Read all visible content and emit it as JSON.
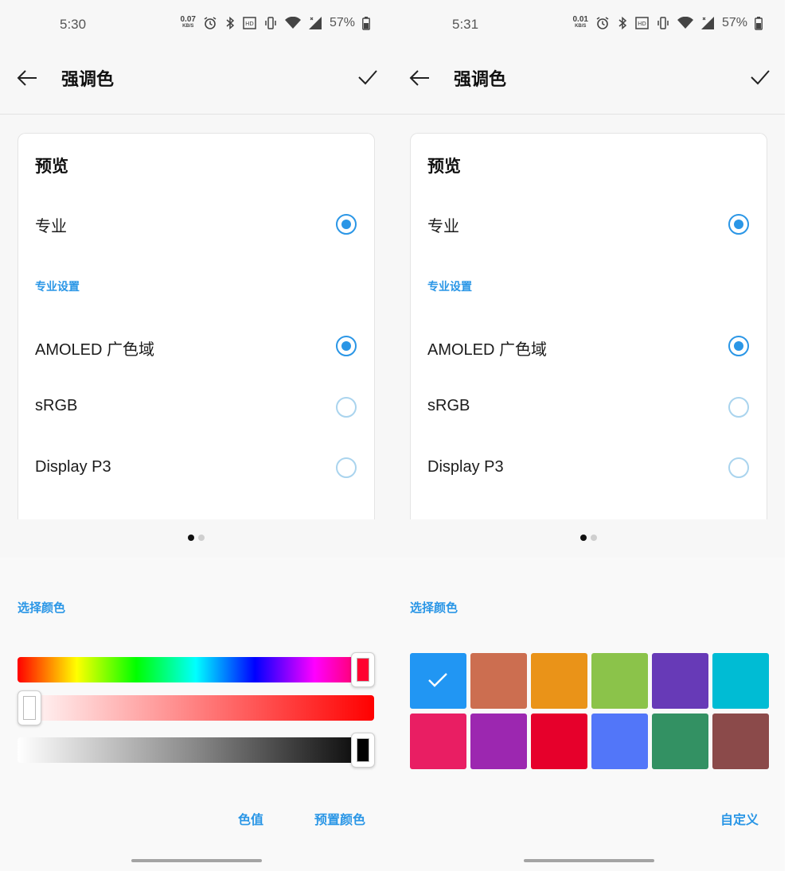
{
  "screens": [
    {
      "status": {
        "time": "5:30",
        "speed_value": "0.07",
        "speed_unit": "KB/S",
        "battery": "57%"
      },
      "title": "强调色",
      "preview": {
        "title": "预览",
        "mode_label": "专业",
        "section": "专业设置",
        "options": [
          "AMOLED 广色域",
          "sRGB",
          "Display P3"
        ],
        "selected_option": "AMOLED 广色域"
      },
      "choose_label": "选择颜色",
      "slider_colors": {
        "hue": "#ff0030",
        "saturation": "#ffffff",
        "value": "#000000"
      },
      "buttons": {
        "value": "色值",
        "preset": "预置颜色"
      }
    },
    {
      "status": {
        "time": "5:31",
        "speed_value": "0.01",
        "speed_unit": "KB/S",
        "battery": "57%"
      },
      "title": "强调色",
      "preview": {
        "title": "预览",
        "mode_label": "专业",
        "section": "专业设置",
        "options": [
          "AMOLED 广色域",
          "sRGB",
          "Display P3"
        ],
        "selected_option": "AMOLED 广色域"
      },
      "choose_label": "选择颜色",
      "swatches": [
        "#2196f3",
        "#cc6e50",
        "#ea9318",
        "#8bc34a",
        "#673ab7",
        "#00bcd4",
        "#e91e63",
        "#9c27b0",
        "#e6002b",
        "#5276f9",
        "#339163",
        "#8b4a4a"
      ],
      "selected_swatch": "#2196f3",
      "buttons": {
        "custom": "自定义"
      }
    }
  ]
}
